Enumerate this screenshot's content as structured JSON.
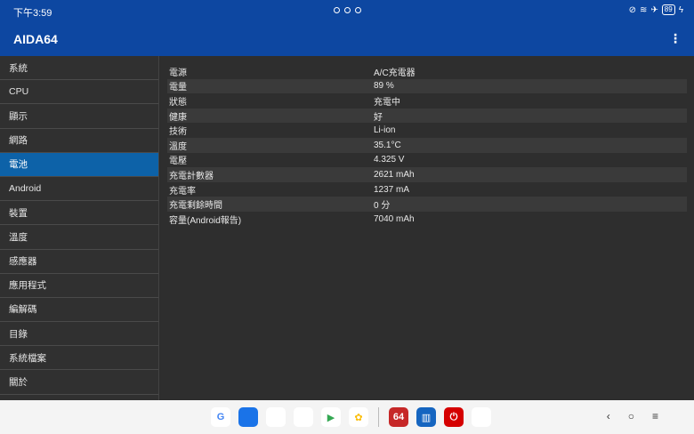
{
  "status": {
    "time": "下午3:59",
    "battery": "89"
  },
  "app": {
    "title": "AIDA64",
    "menu_icon": "⋮"
  },
  "sidebar": {
    "items": [
      {
        "label": "系統"
      },
      {
        "label": "CPU"
      },
      {
        "label": "顯示"
      },
      {
        "label": "網路"
      },
      {
        "label": "電池"
      },
      {
        "label": "Android"
      },
      {
        "label": "裝置"
      },
      {
        "label": "溫度"
      },
      {
        "label": "感應器"
      },
      {
        "label": "應用程式"
      },
      {
        "label": "編解碼"
      },
      {
        "label": "目錄"
      },
      {
        "label": "系統檔案"
      },
      {
        "label": "關於"
      }
    ],
    "active_index": 4
  },
  "battery_info": {
    "rows": [
      {
        "key": "電源",
        "value": "A/C充電器"
      },
      {
        "key": "電量",
        "value": "89 %"
      },
      {
        "key": "狀態",
        "value": "充電中"
      },
      {
        "key": "健康",
        "value": "好"
      },
      {
        "key": "技術",
        "value": "Li-ion"
      },
      {
        "key": "溫度",
        "value": "35.1°C"
      },
      {
        "key": "電壓",
        "value": "4.325 V"
      },
      {
        "key": "充電計數器",
        "value": "2621 mAh"
      },
      {
        "key": "充電率",
        "value": "1237 mA"
      },
      {
        "key": "充電剩餘時間",
        "value": "0 分"
      },
      {
        "key": "容量(Android報告)",
        "value": "7040 mAh"
      }
    ]
  },
  "dock": {
    "apps": [
      {
        "name": "google-icon",
        "glyph": "G",
        "color": "#ffffff",
        "fg": "#4285f4"
      },
      {
        "name": "messages-icon",
        "glyph": "",
        "color": "#1a73e8",
        "fg": "#ffffff"
      },
      {
        "name": "chrome-icon",
        "glyph": "",
        "color": "#ffffff",
        "fg": "#ea4335"
      },
      {
        "name": "assistant-icon",
        "glyph": "",
        "color": "#ffffff",
        "fg": "#4285f4"
      },
      {
        "name": "play-store-icon",
        "glyph": "▶",
        "color": "#ffffff",
        "fg": "#34a853"
      },
      {
        "name": "photos-icon",
        "glyph": "✿",
        "color": "#ffffff",
        "fg": "#fbbc04"
      },
      {
        "name": "aida64-icon",
        "glyph": "64",
        "color": "#c62828",
        "fg": "#ffffff"
      },
      {
        "name": "benchmark-icon",
        "glyph": "▥",
        "color": "#1565c0",
        "fg": "#ffffff"
      },
      {
        "name": "power-app-icon",
        "glyph": "⏻",
        "color": "#d50000",
        "fg": "#ffffff"
      },
      {
        "name": "app-drawer-icon",
        "glyph": "",
        "color": "#ffffff",
        "fg": "#e91e63"
      }
    ]
  },
  "navkeys": {
    "back": "‹",
    "home": "○",
    "recents": "≡"
  }
}
